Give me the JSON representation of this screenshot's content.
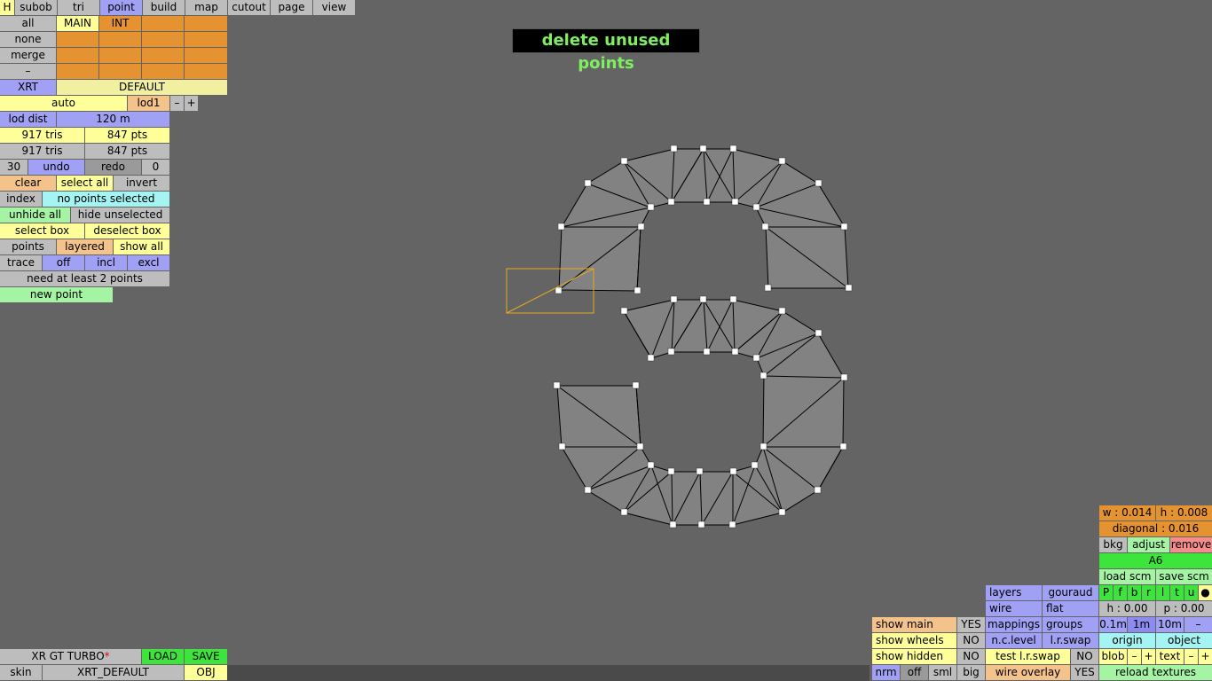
{
  "menu": {
    "h": "H",
    "subob": "subob",
    "tri": "tri",
    "point": "point",
    "build": "build",
    "map": "map",
    "cutout": "cutout",
    "page": "page",
    "view": "view"
  },
  "sel": {
    "all": "all",
    "none": "none",
    "merge": "merge",
    "dash": "–",
    "main": "MAIN",
    "int": "INT"
  },
  "lod": {
    "xrt": "XRT",
    "default": "DEFAULT",
    "auto": "auto",
    "lod1": "lod1",
    "minus": "–",
    "plus": "+",
    "lod_dist": "lod dist",
    "dist_val": "120 m",
    "tris1": "917 tris",
    "pts1": "847 pts",
    "tris2": "917 tris",
    "pts2": "847 pts"
  },
  "edit": {
    "n30": "30",
    "undo": "undo",
    "redo": "redo",
    "n0": "0",
    "clear": "clear",
    "select_all": "select all",
    "invert": "invert",
    "index": "index",
    "status": "no points selected",
    "unhide_all": "unhide all",
    "hide_unselected": "hide unselected",
    "select_box": "select box",
    "deselect_box": "deselect box",
    "points": "points",
    "layered": "layered",
    "show_all": "show all",
    "trace": "trace",
    "off": "off",
    "incl": "incl",
    "excl": "excl",
    "need": "need at least 2 points",
    "new_point": "new point"
  },
  "banner": "delete unused points",
  "file": {
    "car": "XR GT TURBO",
    "star": "*",
    "load": "LOAD",
    "save": "SAVE",
    "skin": "skin",
    "skin_name": "XRT_DEFAULT",
    "obj": "OBJ"
  },
  "view": {
    "show_main": "show main",
    "show_main_v": "YES",
    "show_wheels": "show wheels",
    "show_wheels_v": "NO",
    "show_hidden": "show hidden",
    "show_hidden_v": "NO",
    "nrm": "nrm",
    "off": "off",
    "sml": "sml",
    "big": "big",
    "layers": "layers",
    "gouraud": "gouraud",
    "wire": "wire",
    "flat": "flat",
    "mappings": "mappings",
    "groups": "groups",
    "nclevel": "n.c.level",
    "lrswap": "l.r.swap",
    "test_lrswap": "test l.r.swap",
    "test_lrswap_v": "NO",
    "wire_overlay": "wire overlay",
    "wire_overlay_v": "YES"
  },
  "bkg": {
    "w": "w : 0.014",
    "h": "h : 0.008",
    "diagonal": "diagonal : 0.016",
    "bkg": "bkg",
    "adjust": "adjust",
    "remove": "remove",
    "a6": "A6",
    "load_scm": "load scm",
    "save_scm": "save scm",
    "letters": [
      "P",
      "f",
      "b",
      "r",
      "l",
      "t",
      "u",
      "●"
    ],
    "hval": "h : 0.00",
    "pval": "p : 0.00",
    "s01": "0.1m",
    "s1": "1m",
    "s10": "10m",
    "sdash": "–",
    "origin": "origin",
    "object": "object",
    "blob": "blob",
    "bminus": "–",
    "bplus": "+",
    "text": "text",
    "tminus": "–",
    "tplus": "+",
    "reload": "reload textures"
  }
}
